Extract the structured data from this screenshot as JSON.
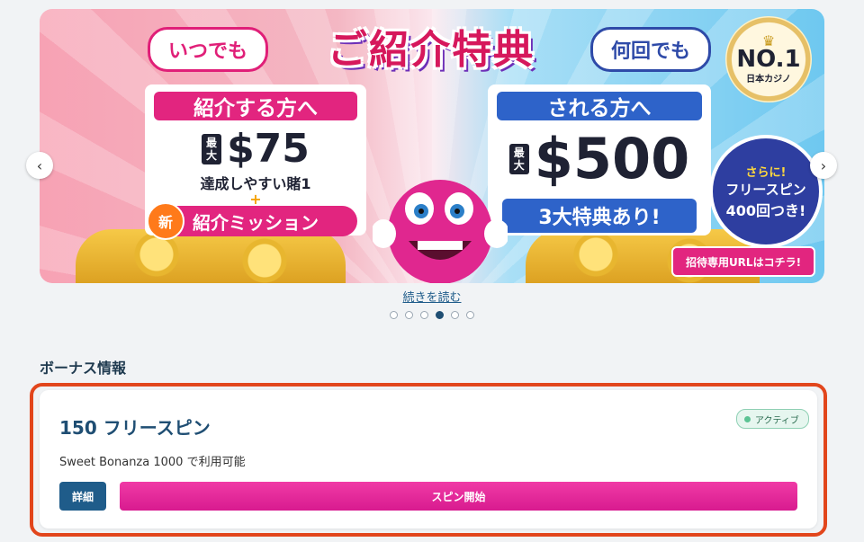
{
  "banner": {
    "left_pill": "いつでも",
    "right_pill": "何回でも",
    "title": "ご紹介特典",
    "left_panel": {
      "heading": "紹介する方へ",
      "max_tag": "最大",
      "amount": "$75",
      "sub": "達成しやすい賭1",
      "plus": "+",
      "new_badge": "新",
      "mission": "紹介ミッション"
    },
    "right_panel": {
      "heading": "される方へ",
      "max_tag": "最大",
      "amount": "$500",
      "feature": "3大特典あり!"
    },
    "seal": {
      "top": "NO.",
      "number": "1",
      "bottom": "日本カジノ"
    },
    "spin_circle": {
      "line1": "さらに!",
      "line2": "フリースピン",
      "line3": "400回つき!"
    },
    "invite_button": "招待専用URLはコチラ!"
  },
  "carousel": {
    "prev_icon": "‹",
    "next_icon": "›",
    "read_more": "続きを読む",
    "total_slides": 6,
    "active_slide": 4
  },
  "bonus_section": {
    "title": "ボーナス情報",
    "card": {
      "title": "150 フリースピン",
      "status": "アクティブ",
      "description": "Sweet Bonanza 1000 で利用可能",
      "detail_button": "詳細",
      "spin_button": "スピン開始"
    }
  },
  "colors": {
    "accent_pink": "#e2257f",
    "accent_blue": "#1f5c8a",
    "highlight_border": "#e2461c",
    "active_green": "#5cc394"
  }
}
